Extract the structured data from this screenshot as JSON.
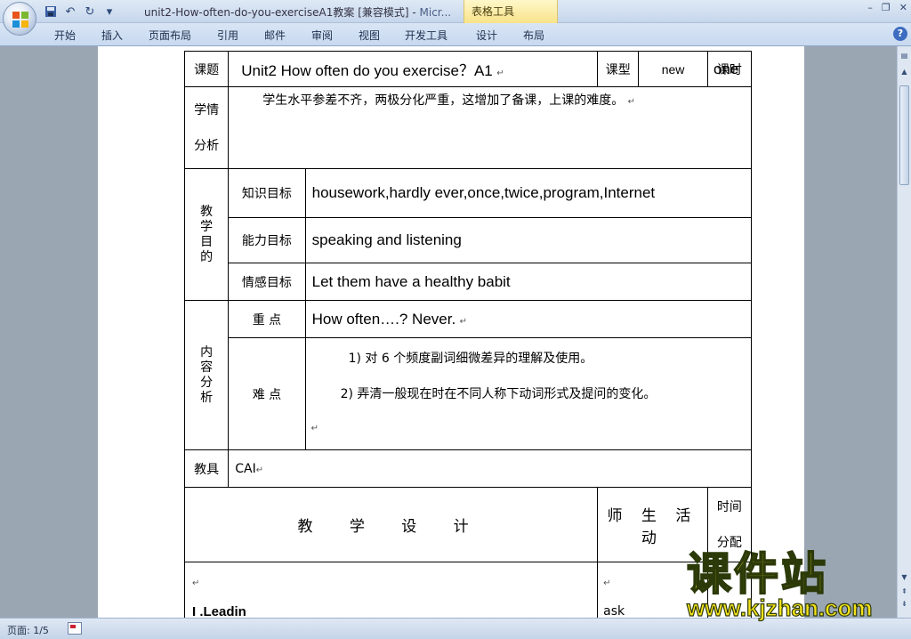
{
  "titlebar": {
    "document_title": "unit2-How-often-do-you-exerciseA1教案 [兼容模式] - ",
    "app_name": "Micr...",
    "context_tab": "表格工具",
    "quick_access": [
      "save-icon",
      "undo-icon",
      "redo-icon",
      "customize-icon"
    ]
  },
  "ribbon": {
    "tabs": [
      "开始",
      "插入",
      "页面布局",
      "引用",
      "邮件",
      "审阅",
      "视图",
      "开发工具",
      "设计",
      "布局"
    ],
    "help": "?"
  },
  "document": {
    "row_course": {
      "label": "课题",
      "title": "Unit2 How often do you exercise？A1",
      "type_label": "课型",
      "type_value": "new",
      "period_label": "课时",
      "period_value": "one"
    },
    "row_analysis": {
      "label_line1": "学情",
      "label_line2": "分析",
      "text": "学生水平参差不齐，两极分化严重，这增加了备课，上课的难度。"
    },
    "row_goals": {
      "label": "教学目的",
      "knowledge_label": "知识目标",
      "knowledge_value": "housework,hardly ever,once,twice,program,Internet",
      "ability_label": "能力目标",
      "ability_value": "speaking and listening",
      "emotion_label": "情感目标",
      "emotion_value": "Let them have a healthy babit"
    },
    "row_content": {
      "label": "内容分析",
      "key_label": "重 点",
      "key_value": "How often….? Never.",
      "difficulty_label": "难 点",
      "difficulty_items": [
        "1) 对 6 个频度副词细微差异的理解及使用。",
        "2) 弄清一般现在时在不同人称下动词形式及提问的变化。"
      ]
    },
    "row_tools": {
      "label": "教具",
      "value": "CAI"
    },
    "row_design": {
      "design_label": "教 学 设 计",
      "activity_label": "师 生 活 动",
      "time_line1": "时间",
      "time_line2": "分配"
    },
    "row_body": {
      "first_heading": "I .Leadin",
      "activity_start": "ask"
    }
  },
  "statusbar": {
    "page_info": "页面: 1/5"
  },
  "watermark": {
    "chinese": "课件站",
    "url": "www.kjzhan.com"
  }
}
